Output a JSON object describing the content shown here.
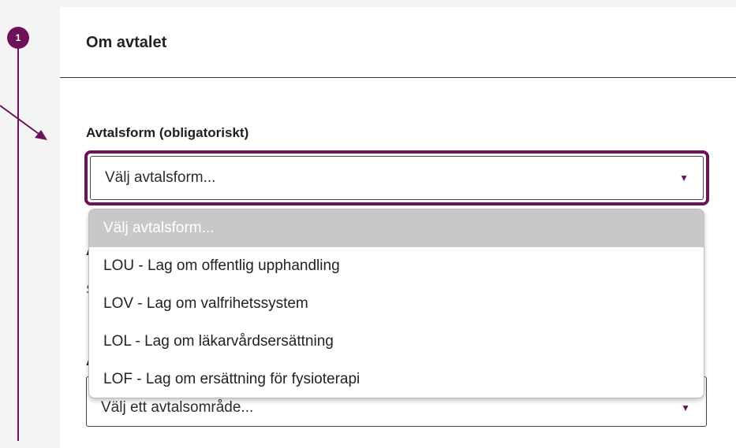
{
  "step": {
    "number": "1"
  },
  "card": {
    "title": "Om avtalet"
  },
  "agreement_form": {
    "label": "Avtalsform (obligatoriskt)",
    "selected_value": "Välj avtalsform...",
    "options": [
      "Välj avtalsform...",
      "LOU - Lag om offentlig upphandling",
      "LOV - Lag om valfrihetssystem",
      "LOL - Lag om läkarvårdsersättning",
      "LOF - Lag om ersättning för fysioterapi"
    ]
  },
  "obscured": {
    "label_fragment_1": "A",
    "text_fragment": "S",
    "label_fragment_2": "A"
  },
  "agreement_area": {
    "selected_value": "Välj ett avtalsområde..."
  },
  "colors": {
    "accent": "#6d1257",
    "placeholder_option_bg": "#c8c8c8"
  },
  "icons": {
    "caret": "chevron-down-icon",
    "annotation": "arrow-icon"
  }
}
